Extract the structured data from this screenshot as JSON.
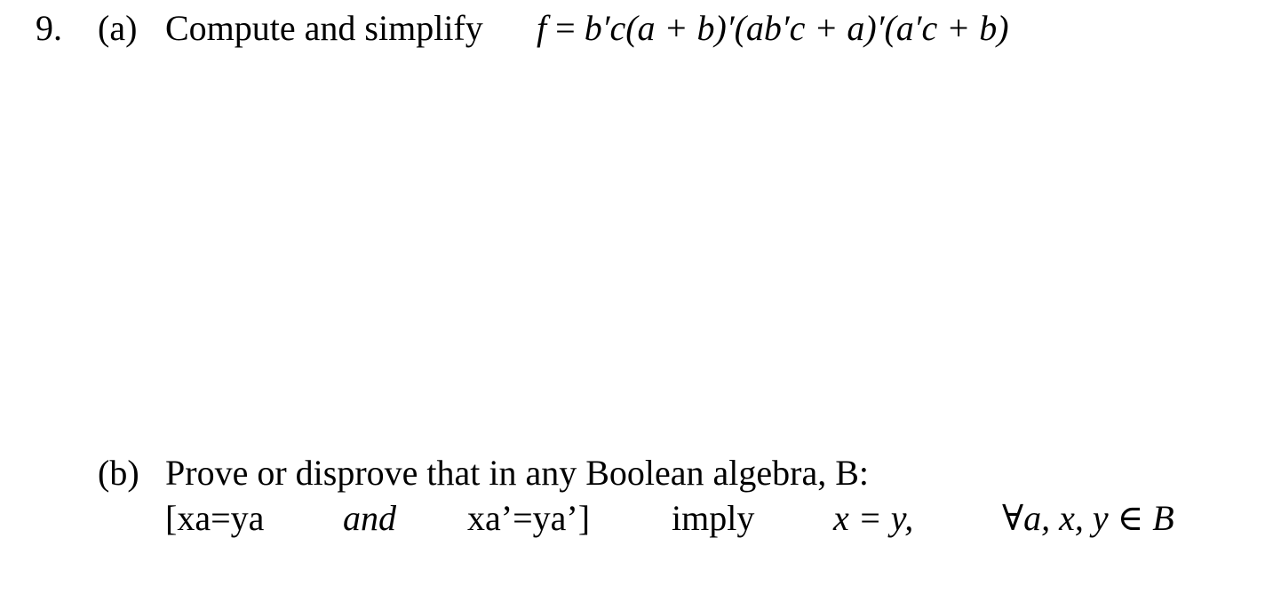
{
  "problem": {
    "number": "9.",
    "part_a": {
      "label": "(a)",
      "text": "Compute and simplify",
      "formula": {
        "lhs": "f",
        "eq": " = ",
        "rhs": "b′c(a + b)′(ab′c + a)′(a′c + b)"
      }
    },
    "part_b": {
      "label": "(b)",
      "text": "Prove or disprove that in any Boolean algebra, B:",
      "statement": {
        "condition_1": "[xa=ya",
        "connector": "and",
        "condition_2": "xa’=ya’]",
        "implies_word": "imply",
        "conclusion": "x = y,",
        "quantifier": "∀a, x, y ∈ B"
      }
    }
  }
}
